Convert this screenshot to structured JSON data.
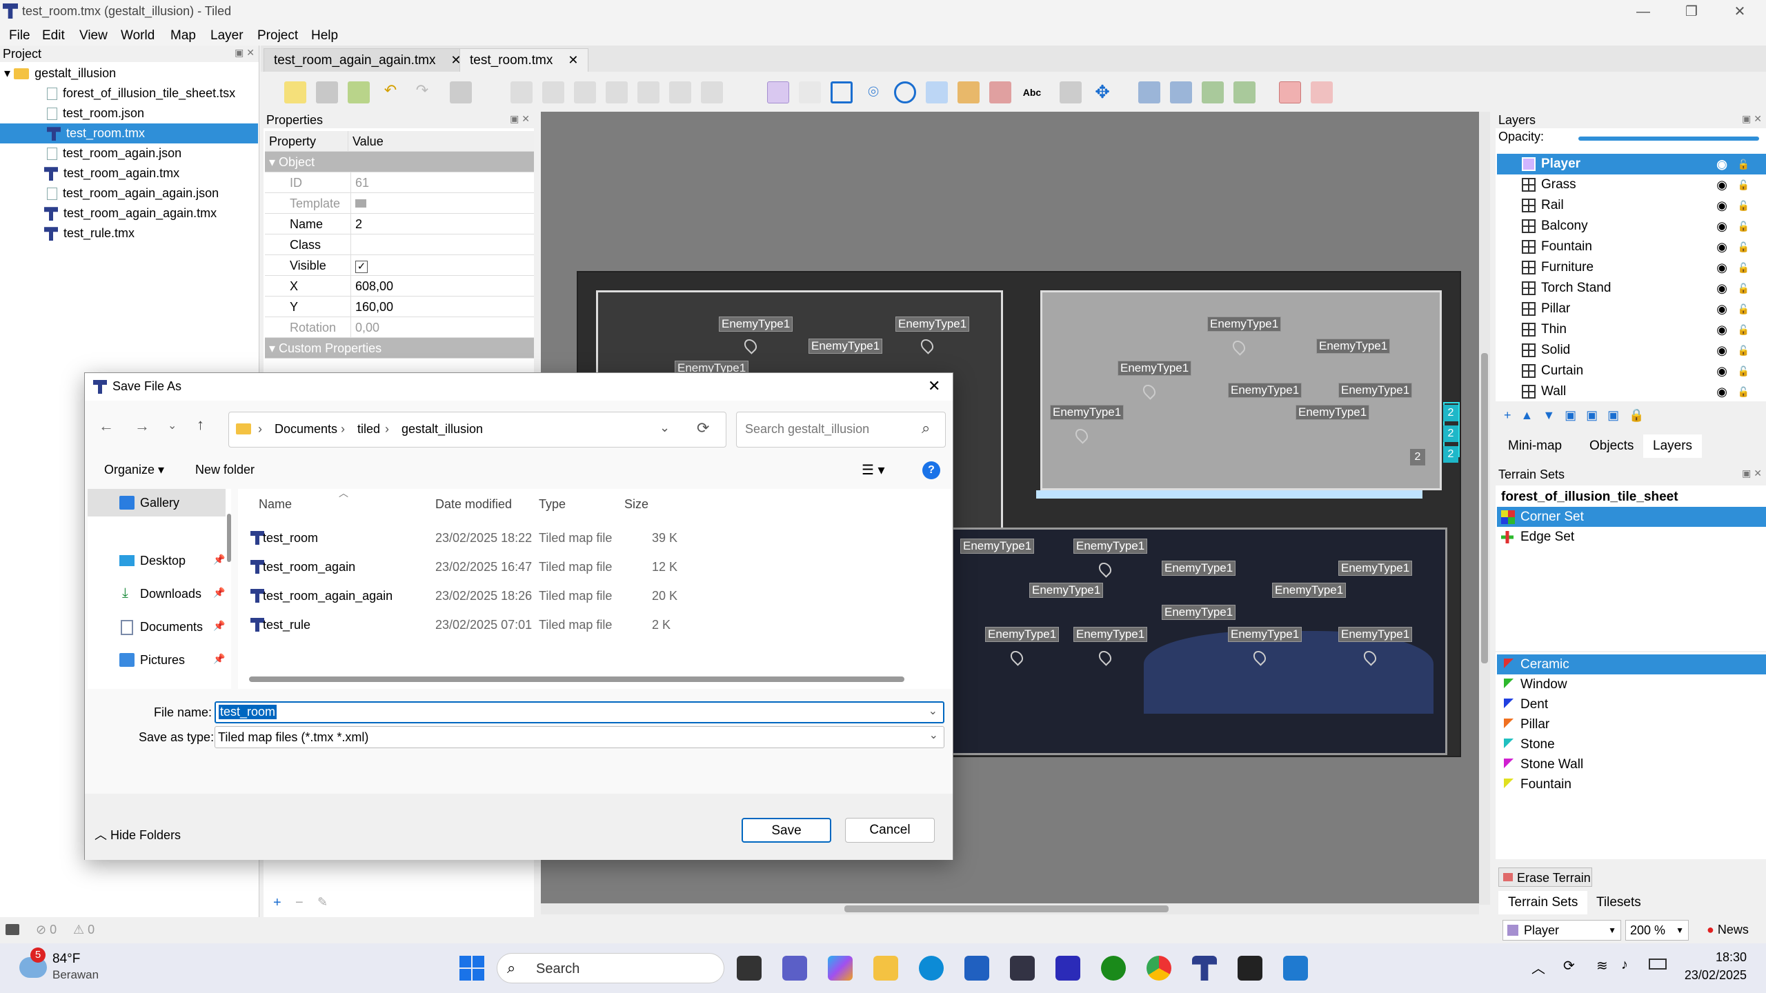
{
  "window": {
    "title": "test_room.tmx (gestalt_illusion) - Tiled"
  },
  "menu": [
    "File",
    "Edit",
    "View",
    "World",
    "Map",
    "Layer",
    "Project",
    "Help"
  ],
  "project_panel": {
    "title": "Project",
    "root": "gestalt_illusion",
    "items": [
      "forest_of_illusion_tile_sheet.tsx",
      "test_room.json",
      "test_room.tmx",
      "test_room_again.json",
      "test_room_again.tmx",
      "test_room_again_again.json",
      "test_room_again_again.tmx",
      "test_rule.tmx"
    ],
    "selected": "test_room.tmx"
  },
  "tabs": [
    {
      "label": "test_room_again_again.tmx",
      "close": "✕"
    },
    {
      "label": "test_room.tmx",
      "close": "✕"
    }
  ],
  "properties": {
    "title": "Properties",
    "col_property": "Property",
    "col_value": "Value",
    "group_object": "Object",
    "rows": [
      {
        "k": "ID",
        "v": "61"
      },
      {
        "k": "Template",
        "v": ""
      },
      {
        "k": "Name",
        "v": "2"
      },
      {
        "k": "Class",
        "v": ""
      },
      {
        "k": "Visible",
        "v": "✓"
      },
      {
        "k": "X",
        "v": "608,00"
      },
      {
        "k": "Y",
        "v": "160,00"
      },
      {
        "k": "Rotation",
        "v": "0,00"
      }
    ],
    "group_custom": "Custom Properties"
  },
  "map": {
    "enemy_label": "EnemyType1",
    "number_badges": [
      "2",
      "2",
      "2",
      "2"
    ]
  },
  "layers_panel": {
    "title": "Layers",
    "opacity_label": "Opacity:",
    "items": [
      "Player",
      "Grass",
      "Rail",
      "Balcony",
      "Fountain",
      "Furniture",
      "Torch Stand",
      "Pillar",
      "Thin",
      "Solid",
      "Curtain",
      "Wall"
    ],
    "selected": "Player",
    "tabs": [
      "Mini-map",
      "Objects",
      "Layers"
    ]
  },
  "terrain_sets": {
    "title": "Terrain Sets",
    "tileset": "forest_of_illusion_tile_sheet",
    "sets": [
      "Corner Set",
      "Edge Set"
    ],
    "terrains": [
      {
        "name": "Ceramic",
        "color": "#e03030"
      },
      {
        "name": "Window",
        "color": "#2db82d"
      },
      {
        "name": "Dent",
        "color": "#2040e0"
      },
      {
        "name": "Pillar",
        "color": "#f07020"
      },
      {
        "name": "Stone",
        "color": "#20c0c0"
      },
      {
        "name": "Stone Wall",
        "color": "#d020d0"
      },
      {
        "name": "Fountain",
        "color": "#e0e020"
      }
    ],
    "erase_button": "Erase Terrain",
    "tabs": [
      "Terrain Sets",
      "Tilesets"
    ]
  },
  "statusbar": {
    "errors": "0",
    "warnings": "0",
    "layer_select": "Player",
    "zoom": "200 %",
    "news": "News"
  },
  "dialog": {
    "title": "Save File As",
    "breadcrumb": [
      "Documents",
      "tiled",
      "gestalt_illusion"
    ],
    "search_placeholder": "Search gestalt_illusion",
    "organize": "Organize",
    "new_folder": "New folder",
    "nav": [
      {
        "label": "Gallery",
        "pinned": false
      },
      {
        "label": "Desktop",
        "pinned": true
      },
      {
        "label": "Downloads",
        "pinned": true
      },
      {
        "label": "Documents",
        "pinned": true
      },
      {
        "label": "Pictures",
        "pinned": true
      }
    ],
    "columns": {
      "name": "Name",
      "date": "Date modified",
      "type": "Type",
      "size": "Size"
    },
    "files": [
      {
        "name": "test_room",
        "date": "23/02/2025 18:22",
        "type": "Tiled map file",
        "size": "39 K"
      },
      {
        "name": "test_room_again",
        "date": "23/02/2025 16:47",
        "type": "Tiled map file",
        "size": "12 K"
      },
      {
        "name": "test_room_again_again",
        "date": "23/02/2025 18:26",
        "type": "Tiled map file",
        "size": "20 K"
      },
      {
        "name": "test_rule",
        "date": "23/02/2025 07:01",
        "type": "Tiled map file",
        "size": "2 K"
      }
    ],
    "file_name_label": "File name:",
    "file_name_value": "test_room",
    "save_type_label": "Save as type:",
    "save_type_value": "Tiled map files (*.tmx *.xml)",
    "hide_folders": "Hide Folders",
    "save": "Save",
    "cancel": "Cancel"
  },
  "taskbar": {
    "weather_temp": "84°F",
    "weather_desc": "Berawan",
    "weather_badge": "5",
    "search": "Search",
    "time": "18:30",
    "date": "23/02/2025"
  }
}
